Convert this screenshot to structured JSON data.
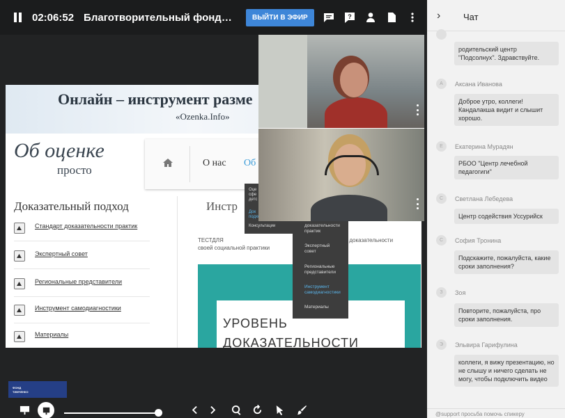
{
  "topbar": {
    "timer": "02:06:52",
    "title": "Благотворительный фонда Елен…",
    "live_button": "ВЫЙТИ В ЭФИР",
    "icons": [
      "chat-icon",
      "question-icon",
      "person-icon",
      "document-icon",
      "more-icon"
    ]
  },
  "slide": {
    "banner_title": "Онлайн – инструмент разме",
    "banner_subtitle": "«Ozenka.Info»",
    "logo_line1": "Об оценке",
    "logo_line2": "просто",
    "nav_about": "О нас",
    "nav_partial": "Об",
    "left_heading": "Доказательный подход",
    "right_heading": "Инстр",
    "links": [
      "Стандарт доказательности практик",
      "Экспертный совет",
      "Региональные представители",
      "Инструмент самодиагностики",
      "Материалы"
    ],
    "paragraph_left": "ТЕСТДЛЯ",
    "paragraph_right": "ровень доказательности",
    "paragraph_line2": "своей социальной практики",
    "big_line1": "УРОВЕНЬ",
    "big_line2": "ДОКАЗАТЕЛЬНОСТИ",
    "dropdown1": [
      "Оце",
      "сфе",
      "детс",
      "Док",
      "подход",
      "Консультации"
    ],
    "dropdown2": [
      "доказательности",
      "практик",
      "Экспертный",
      "совет",
      "Региональные",
      "представители",
      "Инструмент",
      "самодиагностики",
      "Материалы"
    ]
  },
  "fund_logo": {
    "line1": "ФОНД",
    "line2": "ТИМЧЕНКО"
  },
  "chat": {
    "title": "Чат",
    "messages": [
      {
        "name": "",
        "avatar": "",
        "text": "родительский центр \"Подсолнух\". Здравствуйте."
      },
      {
        "name": "Аксана Иванова",
        "avatar": "A",
        "text": "Доброе утро, коллеги! Кандалакша видит и слышит хорошо."
      },
      {
        "name": "Екатерина Мурадян",
        "avatar": "E",
        "text": "РБОО \"Центр лечебной педагогиги\""
      },
      {
        "name": "Светлана Лебедева",
        "avatar": "C",
        "text": "Центр содействия Уссурийск"
      },
      {
        "name": "София Тронина",
        "avatar": "C",
        "text": "Подскажите, пожалуйста, какие сроки заполнения?"
      },
      {
        "name": "Зоя",
        "avatar": "З",
        "text": "Повторите, пожалуйста, про сроки заполнения."
      },
      {
        "name": "Эльвира Гарифулина",
        "avatar": "Э",
        "text": "коллеги, я вижу презентацию, но не слышу и ничего сделать не могу, чтобы подключить видео"
      }
    ],
    "input_text": "@support просьба помочь спикеру"
  },
  "colors": {
    "accent": "#3e86d8",
    "teal": "#2aa6a0",
    "chat_bg": "#f2f2f2"
  }
}
